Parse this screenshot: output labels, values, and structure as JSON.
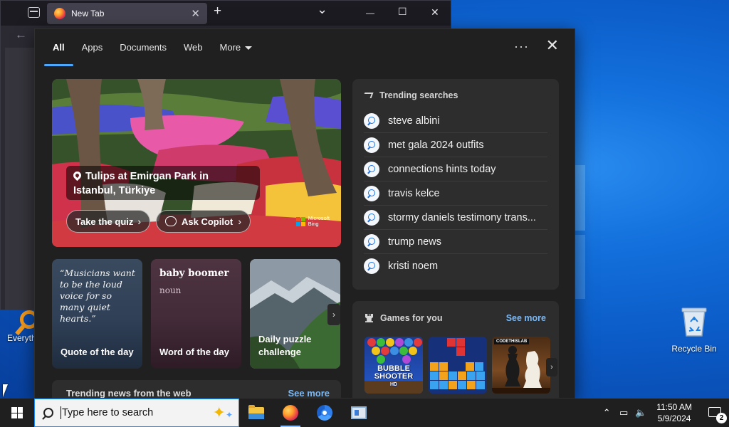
{
  "browser": {
    "tab_title": "New Tab",
    "tab_close": "✕",
    "new_tab": "+",
    "list_tabs": "⌄",
    "minimize": "—",
    "maximize": "☐",
    "close": "✕",
    "back": "←"
  },
  "flyout": {
    "tabs": [
      "All",
      "Apps",
      "Documents",
      "Web",
      "More"
    ],
    "active_tab": "All",
    "options": "···",
    "close": "✕",
    "hero": {
      "title": "Tulips at Emirgan Park in Istanbul, Türkiye",
      "quiz_label": "Take the quiz",
      "copilot_label": "Ask Copilot",
      "chevron": "›",
      "brand_line1": "Microsoft",
      "brand_line2": "Bing"
    },
    "cards": {
      "quote_text": "“Musicians want to be the loud voice for so many quiet hearts.”",
      "quote_label": "Quote of the day",
      "word": "baby boomer",
      "word_pos": "noun",
      "word_label": "Word of the day",
      "puzzle_label": "Daily puzzle challenge",
      "next": "›"
    },
    "news": {
      "title": "Trending news from the web",
      "see_more": "See more"
    },
    "trending": {
      "title": "Trending searches",
      "items": [
        "steve albini",
        "met gala 2024 outfits",
        "connections hints today",
        "travis kelce",
        "stormy daniels testimony trans...",
        "trump news",
        "kristi noem"
      ]
    },
    "games": {
      "title": "Games for you",
      "see_more": "See more",
      "bubble_title": "BUBBLE SHOOTER",
      "bubble_sub": "HD",
      "chess_brand": "CODETHISLAB",
      "next": "›"
    }
  },
  "desktop": {
    "recycle_bin": "Recycle Bin",
    "everything": "Everything"
  },
  "taskbar": {
    "search_placeholder": "Type here to search",
    "time": "11:50 AM",
    "date": "5/9/2024",
    "notifications": "2",
    "tray_chevron": "⌃"
  },
  "colors": {
    "accent": "#4aa8ff",
    "link": "#7ab8f5",
    "flyout_bg": "#202020",
    "panel_bg": "#2d2d2d"
  }
}
